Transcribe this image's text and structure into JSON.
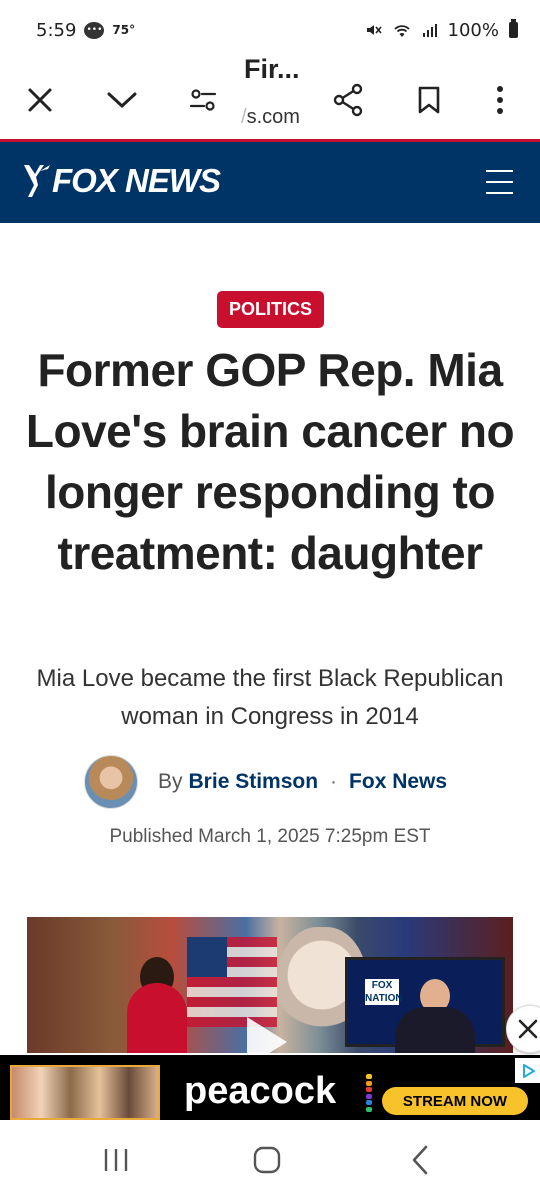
{
  "status_bar": {
    "time": "5:59",
    "temperature": "75°",
    "battery": "100%",
    "icons": [
      "chat-bubble-icon",
      "mute-icon",
      "wifi-icon",
      "signal-icon",
      "battery-icon"
    ]
  },
  "browser": {
    "page_title": "Fir...",
    "url_fade": "/",
    "url": "s.com",
    "buttons": [
      "close-icon",
      "chevron-down-icon",
      "tune-icon",
      "share-icon",
      "bookmark-icon",
      "more-vert-icon"
    ]
  },
  "site": {
    "logo": "FOX NEWS",
    "header_color": "#003366",
    "accent_color": "#c8102e"
  },
  "article": {
    "category": "POLITICS",
    "headline": "Former GOP Rep. Mia Love's brain cancer no longer responding to treatment: daughter",
    "subheadline": "Mia Love became the first Black Republican woman in Congress in 2014",
    "by_label": "By",
    "author": "Brie Stimson",
    "separator": "·",
    "source": "Fox News",
    "published": "Published March 1, 2025 7:25pm EST",
    "video_screen_text": "FOX NATION"
  },
  "ad": {
    "brand": "peacock",
    "cta": "STREAM NOW",
    "dot_colors": [
      "#f7c22a",
      "#f39c1f",
      "#e83b3b",
      "#7a3ad6",
      "#2d7fe0",
      "#2ec26a"
    ]
  },
  "nav": {
    "buttons": [
      "recents-icon",
      "home-icon",
      "back-icon"
    ]
  }
}
